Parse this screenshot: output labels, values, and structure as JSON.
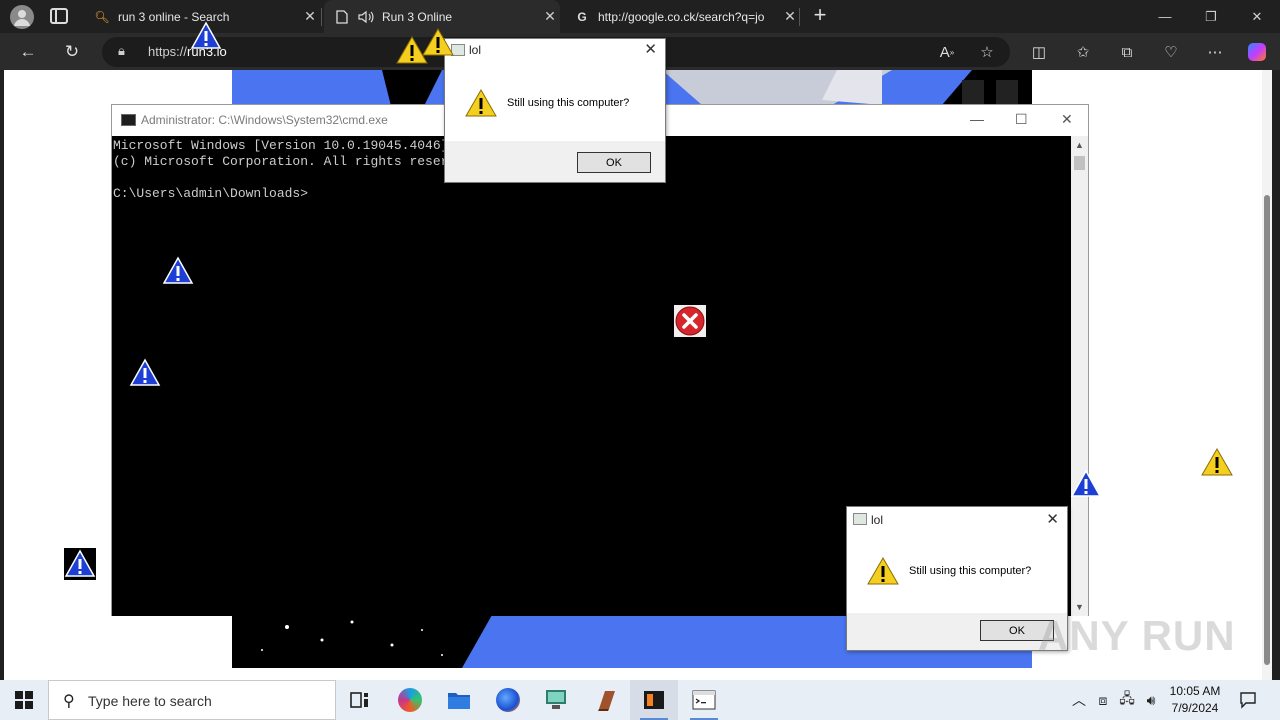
{
  "browser": {
    "tabs": [
      {
        "title": "run 3 online - Search",
        "active": false
      },
      {
        "title": "Run 3 Online",
        "active": true
      },
      {
        "title": "http://google.co.ck/search?q=jo",
        "active": false
      }
    ],
    "address": {
      "prefix": "https://",
      "domain": "run3.io"
    }
  },
  "cmd": {
    "title": "Administrator: C:\\Windows\\System32\\cmd.exe",
    "lines": [
      "Microsoft Windows [Version 10.0.19045.4046]",
      "(c) Microsoft Corporation. All rights reserved.",
      "",
      "C:\\Users\\admin\\Downloads>"
    ]
  },
  "dialogs": [
    {
      "title": "lol",
      "message": "Still using this computer?",
      "ok": "OK"
    },
    {
      "title": "lol",
      "message": "Still using this computer?",
      "ok": "OK"
    }
  ],
  "watermark": "ANY RUN",
  "taskbar": {
    "search_placeholder": "Type here to search",
    "time": "10:05 AM",
    "date": "7/9/2024"
  }
}
